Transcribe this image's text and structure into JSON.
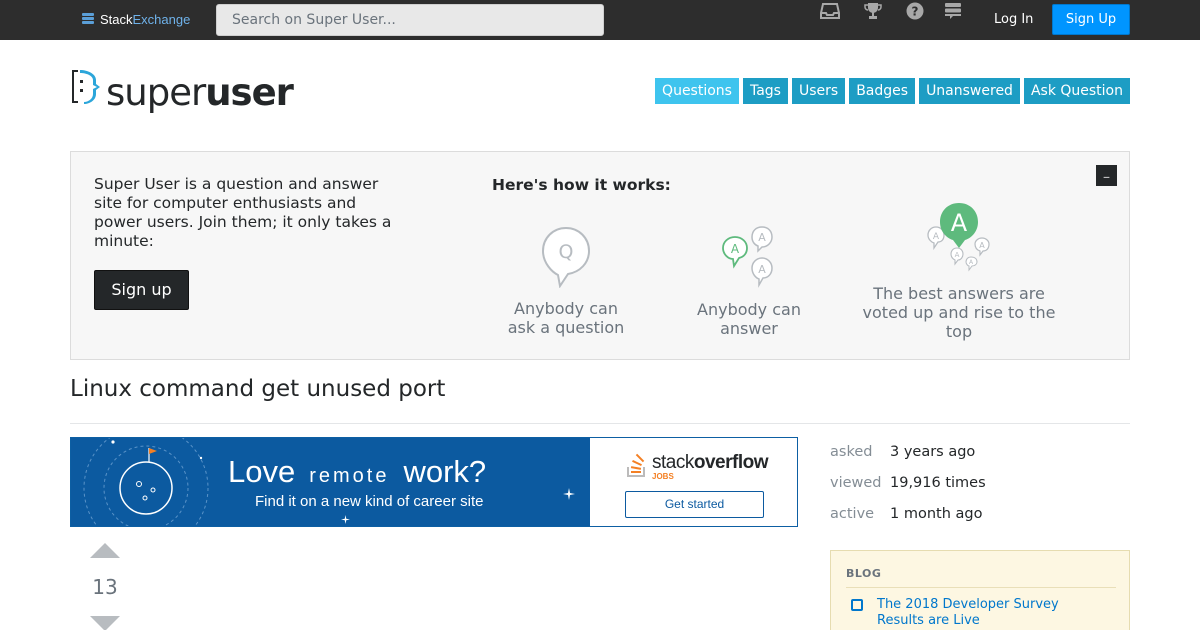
{
  "topbar": {
    "brand_part1": "Stack",
    "brand_part2": "Exchange",
    "search_placeholder": "Search on Super User...",
    "icons": [
      "inbox-icon",
      "achievements-icon",
      "help-icon",
      "site-switcher-icon"
    ],
    "login_label": "Log In",
    "signup_label": "Sign Up",
    "accent": "#0095ff"
  },
  "header": {
    "logo_light": "super",
    "logo_bold": "user",
    "nav": [
      {
        "label": "Questions",
        "active": true
      },
      {
        "label": "Tags"
      },
      {
        "label": "Users"
      },
      {
        "label": "Badges"
      },
      {
        "label": "Unanswered"
      },
      {
        "label": "Ask Question"
      }
    ],
    "nav_color": "#1d9dc4"
  },
  "hero": {
    "description": "Super User is a question and answer site for computer enthusiasts and power users. Join them; it only takes a minute:",
    "signup_label": "Sign up",
    "how_title": "Here's how it works:",
    "close_glyph": "_",
    "steps": [
      {
        "label": "Anybody can ask a question",
        "icon": "question-bubble-icon",
        "glyph": "Q"
      },
      {
        "label": "Anybody can answer",
        "icon": "answers-bubbles-icon",
        "glyph": "A"
      },
      {
        "label": "The best answers are voted up and rise to the top",
        "icon": "best-answer-icon",
        "glyph": "A"
      }
    ]
  },
  "question": {
    "title": "Linux command get unused port",
    "votes": "13"
  },
  "ad": {
    "love": "Love",
    "remote": "remote",
    "work": "work?",
    "tagline": "Find it on a new kind of career site",
    "brand_light": "stack",
    "brand_bold": "overflow",
    "jobs": "JOBS",
    "cta": "Get started"
  },
  "stats": [
    {
      "key": "asked",
      "value": "3 years ago"
    },
    {
      "key": "viewed",
      "value": "19,916 times"
    },
    {
      "key": "active",
      "value": "1 month ago"
    }
  ],
  "blog": {
    "heading": "BLOG",
    "item": "The 2018 Developer Survey Results are Live"
  }
}
